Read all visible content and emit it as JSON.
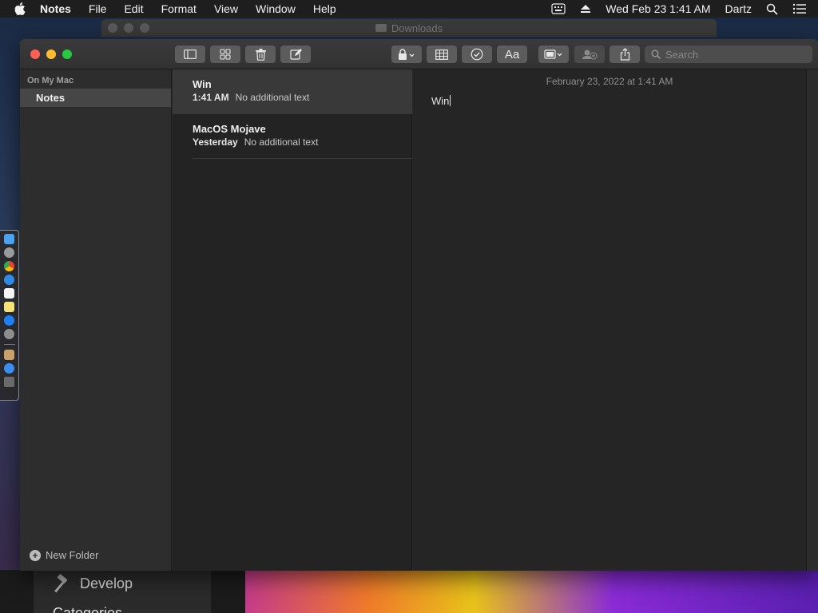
{
  "menubar": {
    "app_name": "Notes",
    "items": [
      "File",
      "Edit",
      "Format",
      "View",
      "Window",
      "Help"
    ],
    "clock": "Wed Feb 23  1:41 AM",
    "user": "Dartz"
  },
  "background": {
    "finder_title": "Downloads",
    "sidebar_develop": "Develop",
    "sidebar_categories": "Categories"
  },
  "toolbar": {
    "font_button_label": "Aa",
    "search_placeholder": "Search"
  },
  "sidebar": {
    "section_title": "On My Mac",
    "folders": [
      {
        "label": "Notes"
      }
    ],
    "new_folder_label": "New Folder"
  },
  "notes": [
    {
      "title": "Win",
      "time": "1:41 AM",
      "preview": "No additional text"
    },
    {
      "title": "MacOS Mojave",
      "time": "Yesterday",
      "preview": "No additional text"
    }
  ],
  "editor": {
    "date": "February 23, 2022 at 1:41 AM",
    "body": "Win"
  },
  "colors": {
    "close": "#ff5f57",
    "minimize": "#febc2e",
    "zoom": "#28c840"
  }
}
